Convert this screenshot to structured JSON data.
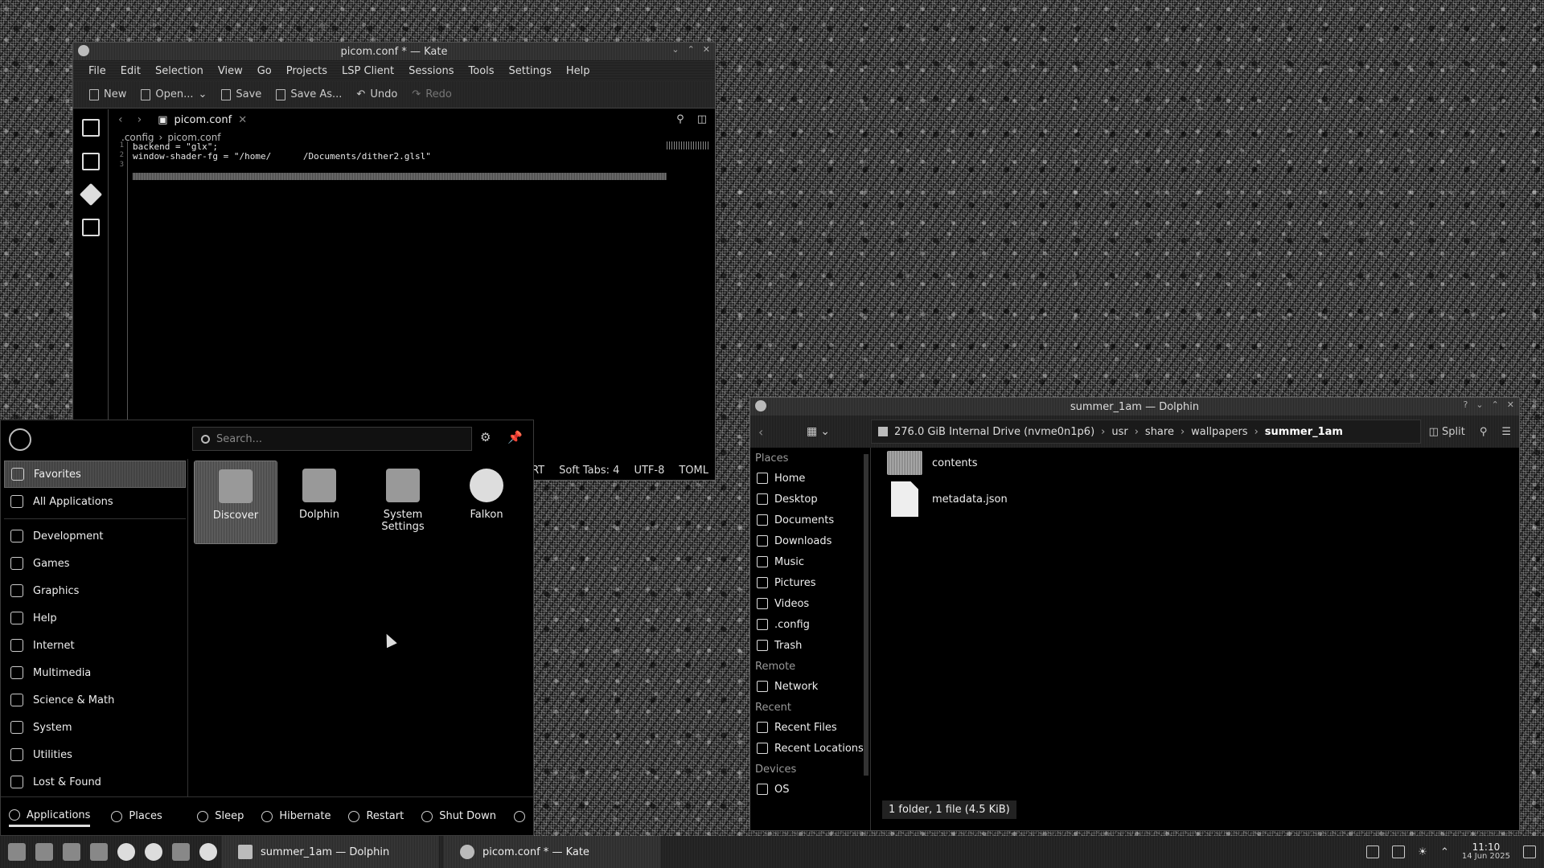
{
  "kate": {
    "title": "picom.conf * — Kate",
    "menu": [
      "File",
      "Edit",
      "Selection",
      "View",
      "Go",
      "Projects",
      "LSP Client",
      "Sessions",
      "Tools",
      "Settings",
      "Help"
    ],
    "toolbar": {
      "new": "New",
      "open": "Open...",
      "save": "Save",
      "save_as": "Save As...",
      "undo": "Undo",
      "redo": "Redo"
    },
    "tab_label": "picom.conf",
    "breadcrumb": [
      ".config",
      "picom.conf"
    ],
    "code_lines": [
      "backend = \"glx\";",
      "window-shader-fg = \"/home/      /Documents/dither2.glsl\""
    ],
    "status": {
      "mode": "ISERT",
      "tabs": "Soft Tabs: 4",
      "encoding": "UTF-8",
      "language": "TOML"
    }
  },
  "dolphin": {
    "title": "summer_1am — Dolphin",
    "split_label": "Split",
    "location": {
      "drive": "276.0 GiB Internal Drive (nvme0n1p6)",
      "parts": [
        "usr",
        "share",
        "wallpapers"
      ],
      "current": "summer_1am"
    },
    "places": {
      "heading": "Places",
      "items": [
        "Home",
        "Desktop",
        "Documents",
        "Downloads",
        "Music",
        "Pictures",
        "Videos",
        ".config",
        "Trash"
      ]
    },
    "remote": {
      "heading": "Remote",
      "items": [
        "Network"
      ]
    },
    "recent": {
      "heading": "Recent",
      "items": [
        "Recent Files",
        "Recent Locations"
      ]
    },
    "devices": {
      "heading": "Devices",
      "items": [
        "OS"
      ]
    },
    "files": [
      {
        "name": "contents",
        "kind": "folder"
      },
      {
        "name": "metadata.json",
        "kind": "file"
      }
    ],
    "status": "1 folder, 1 file (4.5 KiB)"
  },
  "launcher": {
    "search_placeholder": "Search...",
    "categories": [
      "Favorites",
      "All Applications",
      "Development",
      "Games",
      "Graphics",
      "Help",
      "Internet",
      "Multimedia",
      "Science & Math",
      "System",
      "Utilities",
      "Lost & Found"
    ],
    "apps": [
      {
        "name": "Discover"
      },
      {
        "name": "Dolphin"
      },
      {
        "name": "System Settings"
      },
      {
        "name": "Falkon"
      }
    ],
    "bottom": {
      "applications": "Applications",
      "places": "Places",
      "sleep": "Sleep",
      "hibernate": "Hibernate",
      "restart": "Restart",
      "shutdown": "Shut Down"
    }
  },
  "taskbar": {
    "tasks": [
      "summer_1am — Dolphin",
      "picom.conf * — Kate"
    ],
    "time": "11:10",
    "date": "14 Jun 2025"
  }
}
